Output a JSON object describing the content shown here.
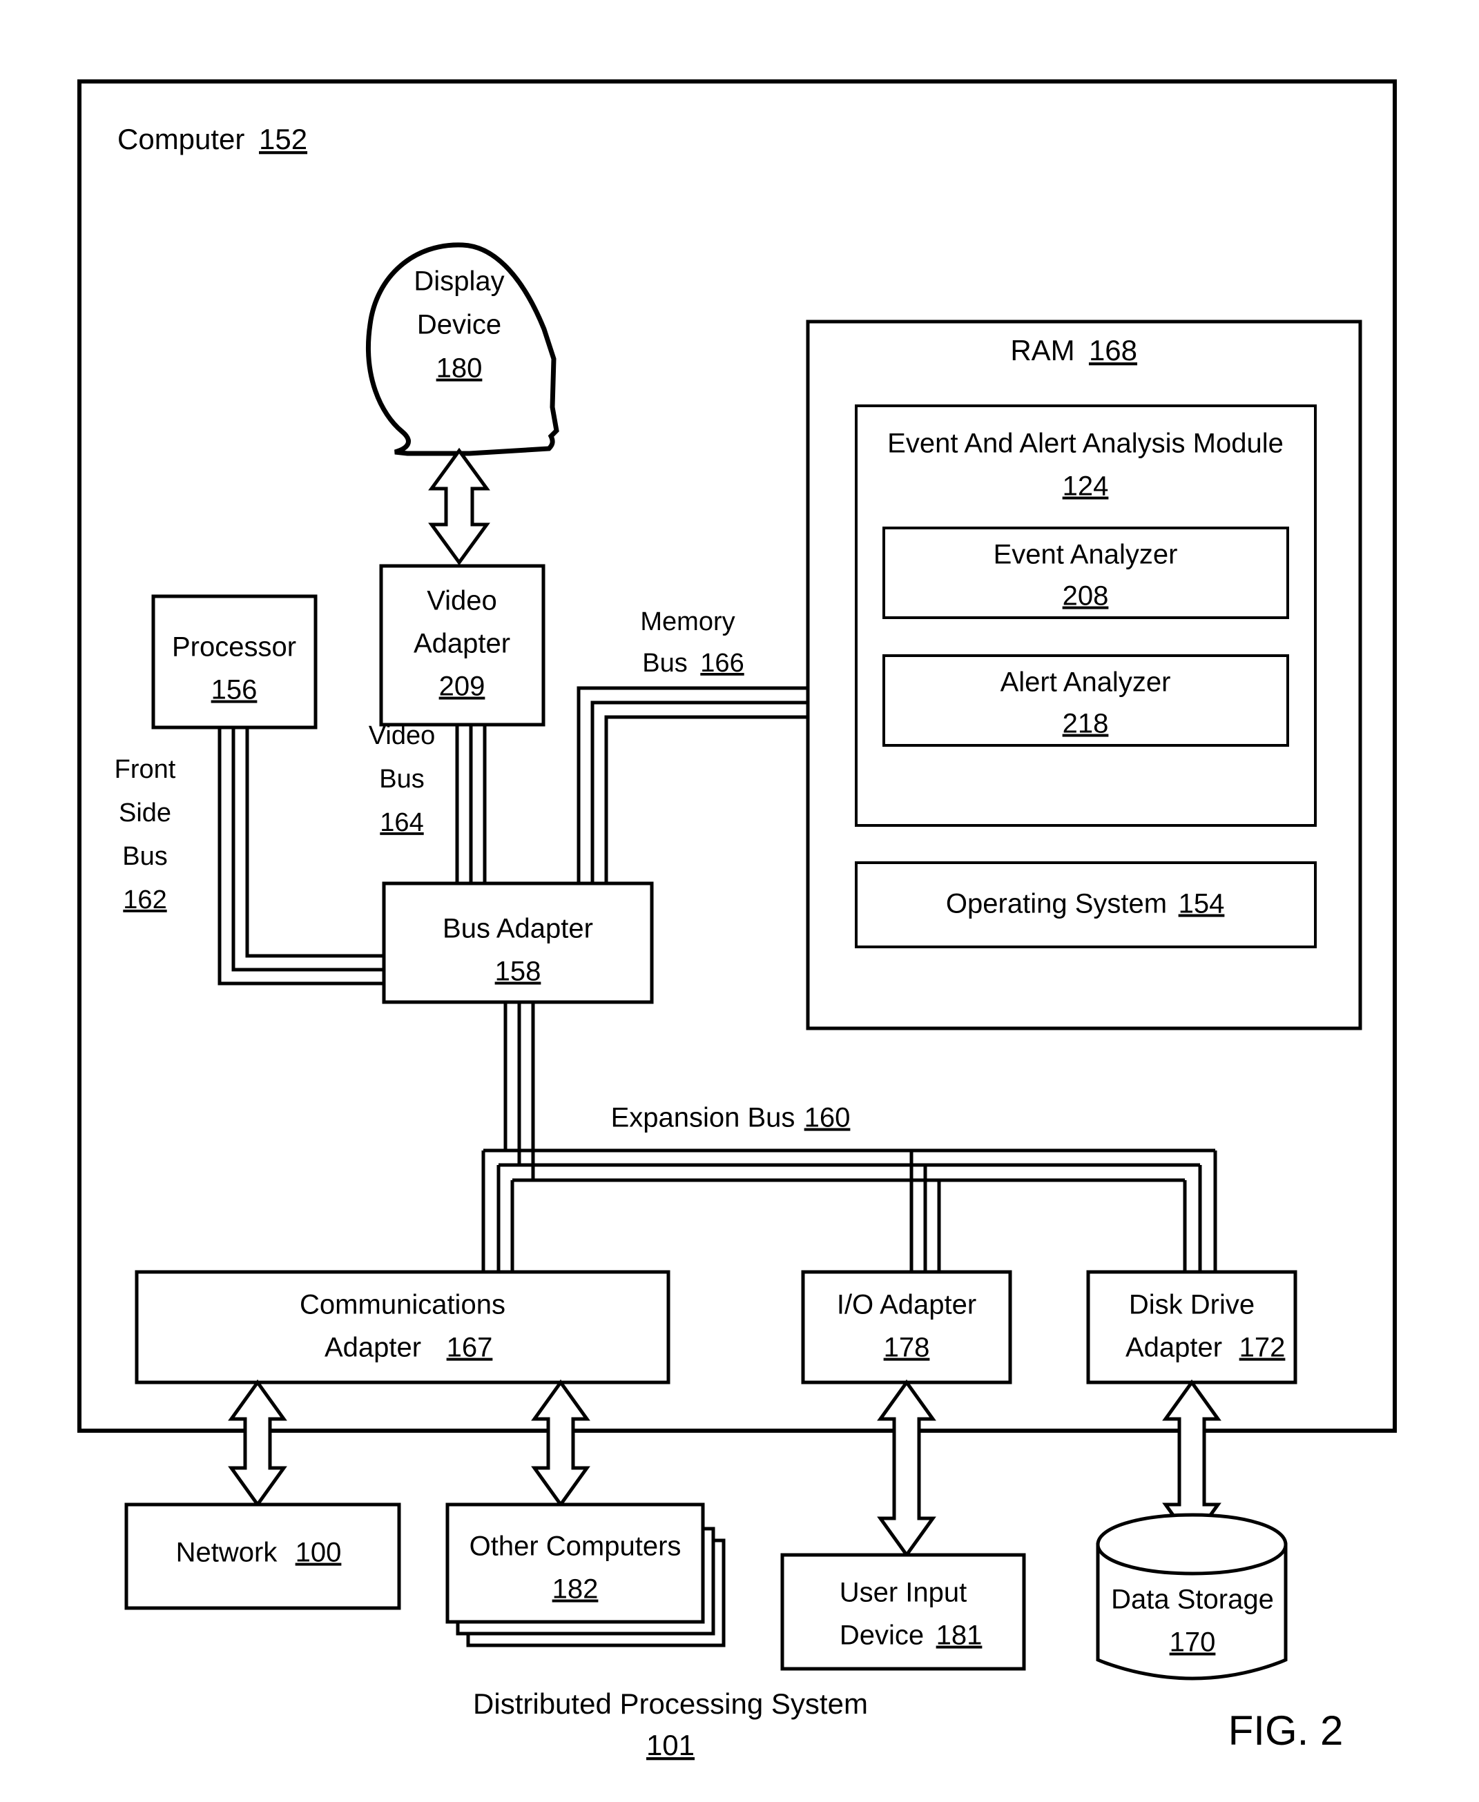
{
  "figure": {
    "label": "FIG. 2",
    "caption_line1": "Distributed Processing System",
    "caption_number": "101"
  },
  "computer": {
    "title": "Computer",
    "number": "152"
  },
  "display_device": {
    "line1": "Display",
    "line2": "Device",
    "number": "180"
  },
  "video_adapter": {
    "line1": "Video",
    "line2": "Adapter",
    "number": "209"
  },
  "processor": {
    "label": "Processor",
    "number": "156"
  },
  "bus_adapter": {
    "label": "Bus Adapter",
    "number": "158"
  },
  "buses": {
    "front_side": {
      "line1": "Front",
      "line2": "Side",
      "line3": "Bus",
      "number": "162"
    },
    "video": {
      "line1": "Video",
      "line2": "Bus",
      "number": "164"
    },
    "memory": {
      "line1": "Memory",
      "line2": "Bus",
      "number": "166"
    },
    "expansion": {
      "label": "Expansion Bus",
      "number": "160"
    }
  },
  "ram": {
    "title": "RAM",
    "number": "168",
    "module": {
      "label": "Event And Alert Analysis Module",
      "number": "124",
      "children": [
        {
          "label": "Event Analyzer",
          "number": "208"
        },
        {
          "label": "Alert Analyzer",
          "number": "218"
        }
      ]
    },
    "operating_system": {
      "label": "Operating System",
      "number": "154"
    }
  },
  "adapters": [
    {
      "id": "communications-adapter",
      "line1": "Communications",
      "line2": "Adapter",
      "number": "167"
    },
    {
      "id": "io-adapter",
      "line1": "I/O Adapter",
      "line2": "",
      "number": "178"
    },
    {
      "id": "disk-drive-adapter",
      "line1": "Disk Drive",
      "line2": "Adapter",
      "number": "172"
    }
  ],
  "peripherals": [
    {
      "id": "network",
      "line1": "Network",
      "line2": "",
      "number": "100"
    },
    {
      "id": "other-computers",
      "line1": "Other Computers",
      "line2": "",
      "number": "182"
    },
    {
      "id": "user-input-device",
      "line1": "User Input",
      "line2": "Device",
      "number": "181"
    },
    {
      "id": "data-storage",
      "line1": "Data Storage",
      "line2": "",
      "number": "170"
    }
  ],
  "colors": {
    "stroke": "#000000",
    "fill": "#ffffff"
  }
}
